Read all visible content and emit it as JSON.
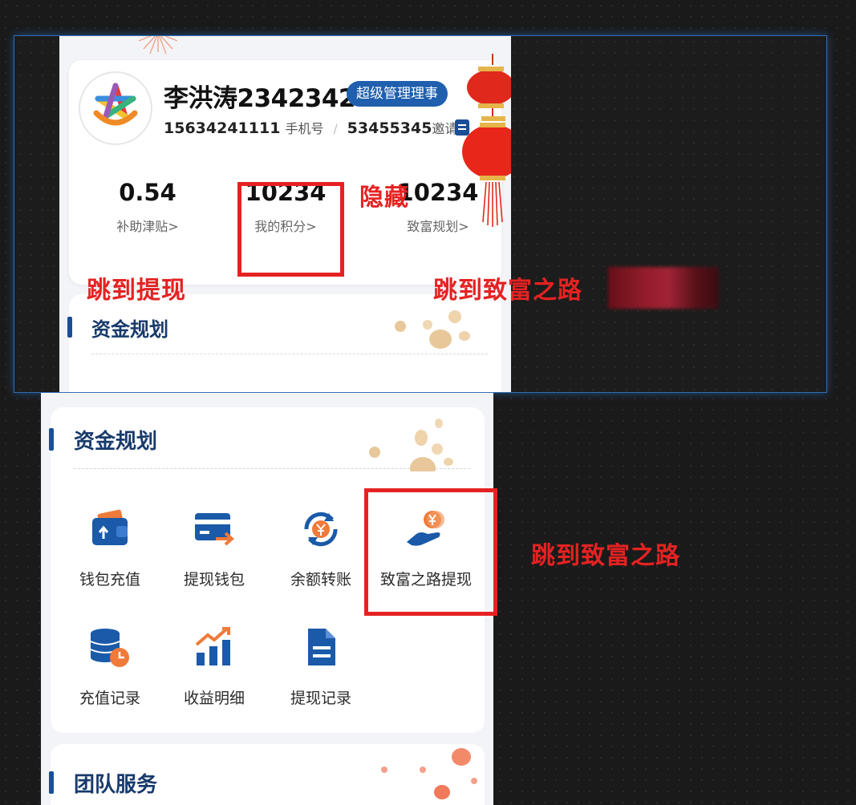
{
  "profile": {
    "name": "李洪涛2342342",
    "role_badge": "超级管理理事",
    "phone": "15634241111",
    "phone_label": "手机号",
    "separator": "/",
    "invite_code": "53455345",
    "invite_label": "邀请码"
  },
  "stats": [
    {
      "value": "0.54",
      "label": "补助津贴"
    },
    {
      "value": "10234",
      "label": "我的积分"
    },
    {
      "value": "10234",
      "label": "致富规划"
    }
  ],
  "chevron": ">",
  "funds": {
    "title": "资金规划",
    "items": [
      {
        "label": "钱包充值",
        "icon": "wallet-icon"
      },
      {
        "label": "提现钱包",
        "icon": "card-transfer-icon"
      },
      {
        "label": "余额转账",
        "icon": "yen-exchange-icon"
      },
      {
        "label": "致富之路提现",
        "icon": "hand-coin-icon"
      },
      {
        "label": "充值记录",
        "icon": "database-clock-icon"
      },
      {
        "label": "收益明细",
        "icon": "bar-chart-growth-icon"
      },
      {
        "label": "提现记录",
        "icon": "document-icon"
      }
    ]
  },
  "team": {
    "title": "团队服务"
  },
  "annotations": {
    "hide": "隐藏",
    "jump_withdraw": "跳到提现",
    "jump_road_top": "跳到致富之路",
    "jump_road_bottom": "跳到致富之路"
  },
  "colors": {
    "accent_blue": "#1f5fae",
    "title_blue": "#183a6c",
    "annotation_red": "#e52222",
    "icon_orange": "#ef7a3a"
  }
}
